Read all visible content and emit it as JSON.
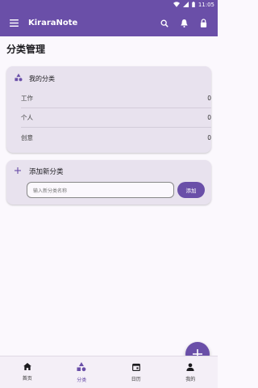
{
  "status": {
    "time": "11:05"
  },
  "app": {
    "title": "KiraraNote"
  },
  "page": {
    "title": "分类管理"
  },
  "categories": {
    "header": "我的分类",
    "items": [
      {
        "label": "工作",
        "count": "0"
      },
      {
        "label": "个人",
        "count": "0"
      },
      {
        "label": "创意",
        "count": "0"
      }
    ]
  },
  "add_category": {
    "header": "添加新分类",
    "placeholder": "输入新分类名称",
    "button_label": "添加"
  },
  "nav": {
    "items": [
      {
        "label": "首页",
        "icon": "home-icon"
      },
      {
        "label": "分类",
        "icon": "category-icon",
        "active": true
      },
      {
        "label": "日历",
        "icon": "calendar-icon"
      },
      {
        "label": "我的",
        "icon": "person-icon"
      }
    ]
  },
  "colors": {
    "primary": "#6a4fa8",
    "card": "#e8e2ee",
    "background": "#fbf8fd"
  }
}
